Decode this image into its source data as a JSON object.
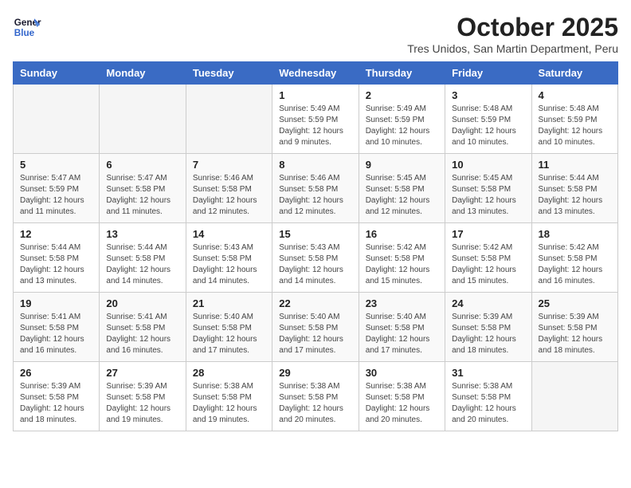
{
  "header": {
    "logo_line1": "General",
    "logo_line2": "Blue",
    "month": "October 2025",
    "location": "Tres Unidos, San Martin Department, Peru"
  },
  "weekdays": [
    "Sunday",
    "Monday",
    "Tuesday",
    "Wednesday",
    "Thursday",
    "Friday",
    "Saturday"
  ],
  "weeks": [
    [
      {
        "day": "",
        "info": ""
      },
      {
        "day": "",
        "info": ""
      },
      {
        "day": "",
        "info": ""
      },
      {
        "day": "1",
        "info": "Sunrise: 5:49 AM\nSunset: 5:59 PM\nDaylight: 12 hours\nand 9 minutes."
      },
      {
        "day": "2",
        "info": "Sunrise: 5:49 AM\nSunset: 5:59 PM\nDaylight: 12 hours\nand 10 minutes."
      },
      {
        "day": "3",
        "info": "Sunrise: 5:48 AM\nSunset: 5:59 PM\nDaylight: 12 hours\nand 10 minutes."
      },
      {
        "day": "4",
        "info": "Sunrise: 5:48 AM\nSunset: 5:59 PM\nDaylight: 12 hours\nand 10 minutes."
      }
    ],
    [
      {
        "day": "5",
        "info": "Sunrise: 5:47 AM\nSunset: 5:59 PM\nDaylight: 12 hours\nand 11 minutes."
      },
      {
        "day": "6",
        "info": "Sunrise: 5:47 AM\nSunset: 5:58 PM\nDaylight: 12 hours\nand 11 minutes."
      },
      {
        "day": "7",
        "info": "Sunrise: 5:46 AM\nSunset: 5:58 PM\nDaylight: 12 hours\nand 12 minutes."
      },
      {
        "day": "8",
        "info": "Sunrise: 5:46 AM\nSunset: 5:58 PM\nDaylight: 12 hours\nand 12 minutes."
      },
      {
        "day": "9",
        "info": "Sunrise: 5:45 AM\nSunset: 5:58 PM\nDaylight: 12 hours\nand 12 minutes."
      },
      {
        "day": "10",
        "info": "Sunrise: 5:45 AM\nSunset: 5:58 PM\nDaylight: 12 hours\nand 13 minutes."
      },
      {
        "day": "11",
        "info": "Sunrise: 5:44 AM\nSunset: 5:58 PM\nDaylight: 12 hours\nand 13 minutes."
      }
    ],
    [
      {
        "day": "12",
        "info": "Sunrise: 5:44 AM\nSunset: 5:58 PM\nDaylight: 12 hours\nand 13 minutes."
      },
      {
        "day": "13",
        "info": "Sunrise: 5:44 AM\nSunset: 5:58 PM\nDaylight: 12 hours\nand 14 minutes."
      },
      {
        "day": "14",
        "info": "Sunrise: 5:43 AM\nSunset: 5:58 PM\nDaylight: 12 hours\nand 14 minutes."
      },
      {
        "day": "15",
        "info": "Sunrise: 5:43 AM\nSunset: 5:58 PM\nDaylight: 12 hours\nand 14 minutes."
      },
      {
        "day": "16",
        "info": "Sunrise: 5:42 AM\nSunset: 5:58 PM\nDaylight: 12 hours\nand 15 minutes."
      },
      {
        "day": "17",
        "info": "Sunrise: 5:42 AM\nSunset: 5:58 PM\nDaylight: 12 hours\nand 15 minutes."
      },
      {
        "day": "18",
        "info": "Sunrise: 5:42 AM\nSunset: 5:58 PM\nDaylight: 12 hours\nand 16 minutes."
      }
    ],
    [
      {
        "day": "19",
        "info": "Sunrise: 5:41 AM\nSunset: 5:58 PM\nDaylight: 12 hours\nand 16 minutes."
      },
      {
        "day": "20",
        "info": "Sunrise: 5:41 AM\nSunset: 5:58 PM\nDaylight: 12 hours\nand 16 minutes."
      },
      {
        "day": "21",
        "info": "Sunrise: 5:40 AM\nSunset: 5:58 PM\nDaylight: 12 hours\nand 17 minutes."
      },
      {
        "day": "22",
        "info": "Sunrise: 5:40 AM\nSunset: 5:58 PM\nDaylight: 12 hours\nand 17 minutes."
      },
      {
        "day": "23",
        "info": "Sunrise: 5:40 AM\nSunset: 5:58 PM\nDaylight: 12 hours\nand 17 minutes."
      },
      {
        "day": "24",
        "info": "Sunrise: 5:39 AM\nSunset: 5:58 PM\nDaylight: 12 hours\nand 18 minutes."
      },
      {
        "day": "25",
        "info": "Sunrise: 5:39 AM\nSunset: 5:58 PM\nDaylight: 12 hours\nand 18 minutes."
      }
    ],
    [
      {
        "day": "26",
        "info": "Sunrise: 5:39 AM\nSunset: 5:58 PM\nDaylight: 12 hours\nand 18 minutes."
      },
      {
        "day": "27",
        "info": "Sunrise: 5:39 AM\nSunset: 5:58 PM\nDaylight: 12 hours\nand 19 minutes."
      },
      {
        "day": "28",
        "info": "Sunrise: 5:38 AM\nSunset: 5:58 PM\nDaylight: 12 hours\nand 19 minutes."
      },
      {
        "day": "29",
        "info": "Sunrise: 5:38 AM\nSunset: 5:58 PM\nDaylight: 12 hours\nand 20 minutes."
      },
      {
        "day": "30",
        "info": "Sunrise: 5:38 AM\nSunset: 5:58 PM\nDaylight: 12 hours\nand 20 minutes."
      },
      {
        "day": "31",
        "info": "Sunrise: 5:38 AM\nSunset: 5:58 PM\nDaylight: 12 hours\nand 20 minutes."
      },
      {
        "day": "",
        "info": ""
      }
    ]
  ]
}
